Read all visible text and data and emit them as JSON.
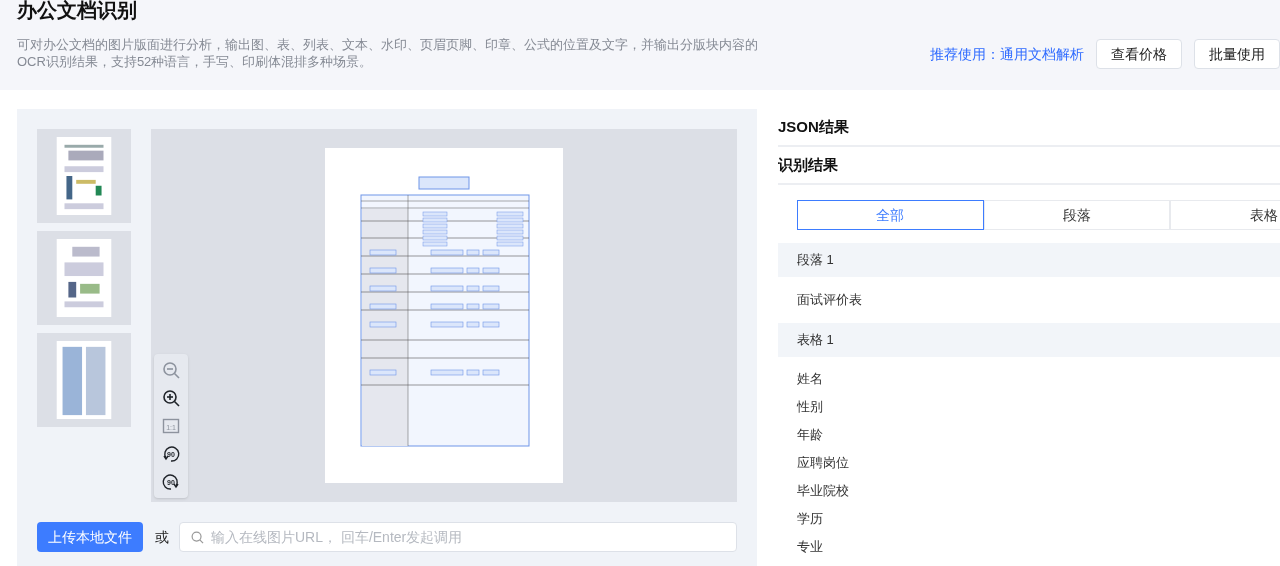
{
  "header": {
    "title": "办公文档识别",
    "description": "可对办公文档的图片版面进行分析，输出图、表、列表、文本、水印、页眉页脚、印章、公式的位置及文字，并输出分版块内容的OCR识别结果，支持52种语言，手写、印刷体混排多种场景。",
    "recommend_link": "推荐使用：通用文档解析",
    "buttons": [
      "查看价格",
      "批量使用"
    ]
  },
  "thumbnails": [
    {
      "kind": "figure",
      "selected": false
    },
    {
      "kind": "diagram",
      "selected": false
    },
    {
      "kind": "text",
      "selected": false
    }
  ],
  "viewer_toolbar": [
    {
      "kind": "zoom_out",
      "disabled": true
    },
    {
      "kind": "zoom_in",
      "disabled": false
    },
    {
      "kind": "actual_size",
      "label": "1:1",
      "disabled": true
    },
    {
      "kind": "rotate_left",
      "label": "90",
      "disabled": false
    },
    {
      "kind": "rotate_right",
      "label": "90",
      "disabled": false
    }
  ],
  "upload": {
    "button": "上传本地文件",
    "or": "或",
    "url_field": {
      "placeholder": "输入在线图片URL， 回车/Enter发起调用"
    }
  },
  "results": {
    "json_heading": "JSON结果",
    "result_heading": "识别结果",
    "tabs": [
      {
        "label": "全部",
        "selected": true
      },
      {
        "label": "段落",
        "selected": false
      },
      {
        "label": "表格",
        "selected": false
      }
    ],
    "sections": [
      {
        "heading": "段落 1",
        "lines": [
          "面试评价表"
        ]
      },
      {
        "heading": "表格 1",
        "lines": [
          "姓名",
          "性别",
          "年龄",
          "应聘岗位",
          "毕业院校",
          "学历",
          "专业"
        ]
      }
    ]
  }
}
